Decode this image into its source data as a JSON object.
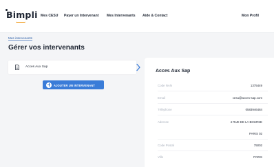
{
  "header": {
    "logo": "Bimpli",
    "nav": [
      {
        "label": "Mes CESU"
      },
      {
        "label": "Payer un Intervenant"
      },
      {
        "label": "Mes Intervenants"
      },
      {
        "label": "Aide & Contact"
      }
    ],
    "profile": "Mon Profil"
  },
  "breadcrumb": "Mes intervenants",
  "page_title": "Gérer vos intervenants",
  "intervenants": [
    {
      "name": "Acces Aux Sap"
    }
  ],
  "add_button_label": "AJOUTER UN INTERVENANT",
  "detail": {
    "title": "Acces Aux Sap",
    "fields": [
      {
        "label": "Code NAN",
        "value": "1375449"
      },
      {
        "label": "Email",
        "value": "cesu@acces-sap.com"
      },
      {
        "label": "Téléphone",
        "value": "0583946484"
      },
      {
        "label": "Adresse",
        "value": "4 RUE DE LA BOURSE",
        "value2": "PARIS 02"
      },
      {
        "label": "Code Postal",
        "value": "75002"
      },
      {
        "label": "Ville",
        "value": "PARIS"
      }
    ]
  },
  "colors": {
    "accent": "#3a7cd8",
    "logo_accent": "#f2a431",
    "link": "#2c5fa8",
    "background": "#f4f5f7"
  }
}
